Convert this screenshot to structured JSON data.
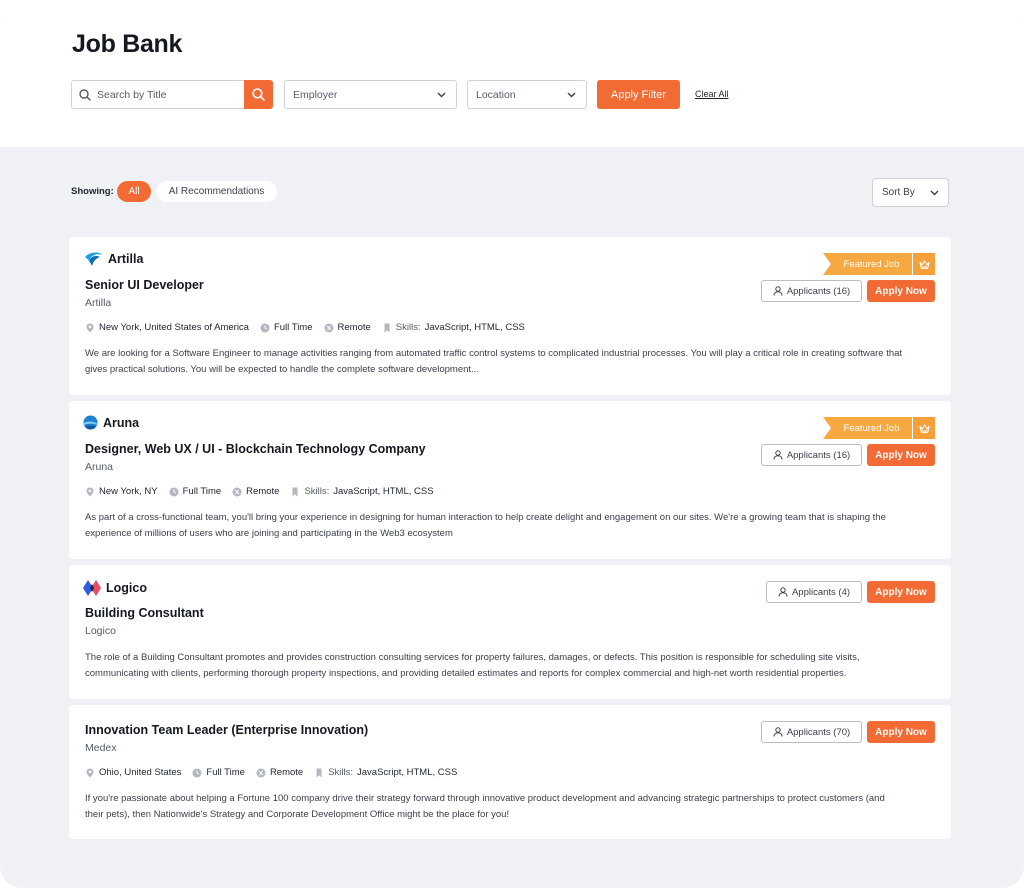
{
  "page": {
    "title": "Job Bank"
  },
  "filters": {
    "search_placeholder": "Search by Title",
    "employer_label": "Employer",
    "location_label": "Location",
    "apply_label": "Apply Filter",
    "clear_label": "Clear All"
  },
  "showing": {
    "label": "Showing:",
    "pills": [
      "All",
      "AI Recommendations"
    ],
    "active": "All"
  },
  "sort": {
    "label": "Sort By"
  },
  "featured_label": "Featured Job",
  "apply_now_label": "Apply Now",
  "skills_label": "Skills:",
  "colors": {
    "accent": "#f26a34",
    "featured": "#f8a840",
    "background": "#f0f1f5"
  },
  "jobs": [
    {
      "logo_name": "Artilla",
      "title": "Senior UI Developer",
      "company": "Artilla",
      "featured": true,
      "applicants": "Applicants (16)",
      "location": "New York, United States of America",
      "type": "Full Time",
      "mode": "Remote",
      "skills": "JavaScript, HTML, CSS",
      "description_lines": [
        "We are looking for a Software Engineer to manage activities ranging from automated traffic control systems to complicated industrial processes. You will play a critical role in creating software that",
        "gives practical solutions. You will be expected to handle the complete software development..."
      ]
    },
    {
      "logo_name": "Aruna",
      "title": "Designer, Web UX / UI - Blockchain Technology Company",
      "company": "Aruna",
      "featured": true,
      "applicants": "Applicants (16)",
      "location": "New York, NY",
      "type": "Full Time",
      "mode": "Remote",
      "skills": "JavaScript, HTML, CSS",
      "description_lines": [
        "As part of a cross-functional team, you'll bring your experience in designing for human interaction to help create delight and engagement on our sites. We're a growing team that is shaping the",
        "experience of millions of users who are joining and participating in the Web3 ecosystem"
      ]
    },
    {
      "logo_name": "Logico",
      "title": "Building Consultant",
      "company": "Logico",
      "featured": false,
      "applicants": "Applicants (4)",
      "description_lines": [
        "The role of a Building Consultant promotes and provides construction consulting services for property failures, damages, or defects. This position is responsible for scheduling site visits,",
        "communicating with clients, performing thorough property inspections, and providing detailed estimates and reports for complex commercial and high-net worth residential properties."
      ]
    },
    {
      "title": "Innovation Team Leader (Enterprise Innovation)",
      "company": "Medex",
      "featured": false,
      "applicants": "Applicants (70)",
      "location": "Ohio, United States",
      "type": "Full Time",
      "mode": "Remote",
      "skills": "JavaScript, HTML, CSS",
      "description_lines": [
        "If you're passionate about helping a Fortune 100 company drive their strategy forward through innovative product development and advancing strategic partnerships to protect customers (and",
        "their pets), then Nationwide's Strategy and Corporate Development Office might be the place for you!"
      ]
    }
  ]
}
